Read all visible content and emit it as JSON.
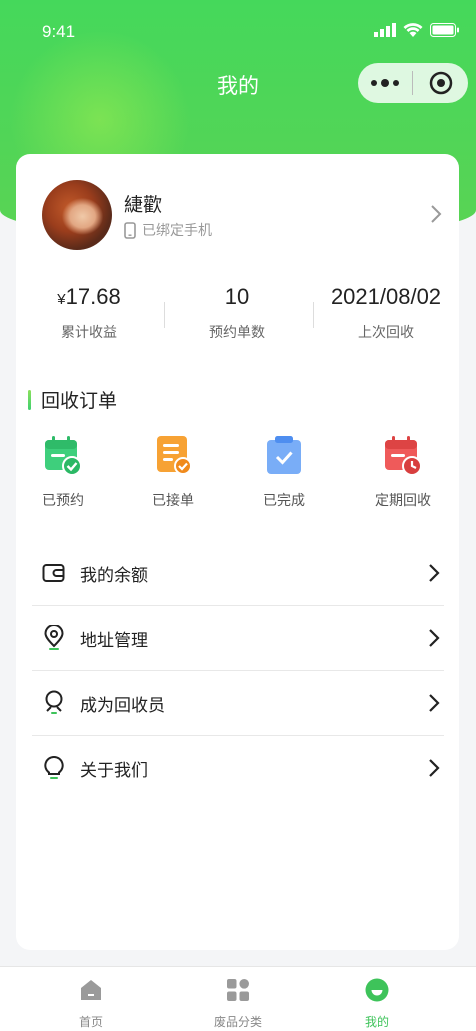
{
  "status_bar": {
    "time": "9:41"
  },
  "nav": {
    "title": "我的"
  },
  "profile": {
    "name": "緁歡",
    "phone_status": "已绑定手机"
  },
  "stats": [
    {
      "currency": "¥",
      "value": "17.68",
      "label": "累计收益"
    },
    {
      "currency": "",
      "value": "10",
      "label": "预约单数"
    },
    {
      "currency": "",
      "value": "2021/08/02",
      "label": "上次回收"
    }
  ],
  "orders": {
    "title": "回收订单",
    "items": [
      {
        "label": "已预约",
        "icon": "calendar-check-icon",
        "color": "#3ecf7c"
      },
      {
        "label": "已接单",
        "icon": "document-check-icon",
        "color": "#f7a234"
      },
      {
        "label": "已完成",
        "icon": "clipboard-check-icon",
        "color": "#5e9cf5"
      },
      {
        "label": "定期回收",
        "icon": "calendar-clock-icon",
        "color": "#ef5a5a"
      }
    ]
  },
  "menu": [
    {
      "label": "我的余额",
      "icon": "wallet-icon"
    },
    {
      "label": "地址管理",
      "icon": "location-pin-icon"
    },
    {
      "label": "成为回收员",
      "icon": "recycler-person-icon"
    },
    {
      "label": "关于我们",
      "icon": "lightbulb-icon"
    }
  ],
  "tabbar": [
    {
      "label": "首页",
      "icon": "home-icon",
      "active": false
    },
    {
      "label": "废品分类",
      "icon": "grid-icon",
      "active": false
    },
    {
      "label": "我的",
      "icon": "profile-smile-icon",
      "active": true
    }
  ],
  "colors": {
    "brand_green": "#45d85b",
    "active_tab": "#3ec35a"
  }
}
